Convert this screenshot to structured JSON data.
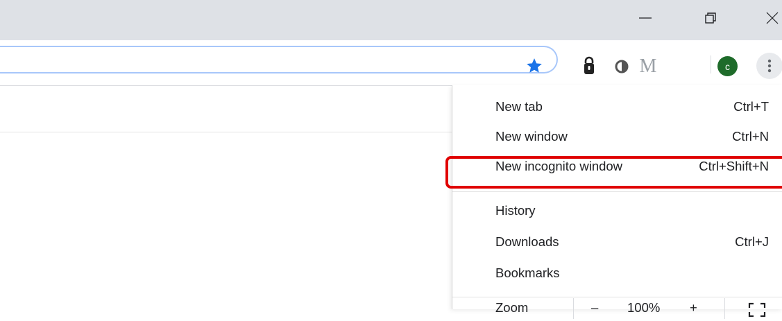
{
  "window_controls": {
    "minimize_icon": "minimize-icon",
    "restore_icon": "restore-icon",
    "close_icon": "close-icon"
  },
  "toolbar": {
    "avatar_letter": "c",
    "extension_m": "M",
    "colors": {
      "star": "#1a73e8",
      "avatar": "#1e6b2a",
      "highlight": "#e00000"
    }
  },
  "menu": {
    "items": [
      {
        "label": "New tab",
        "shortcut": "Ctrl+T"
      },
      {
        "label": "New window",
        "shortcut": "Ctrl+N"
      },
      {
        "label": "New incognito window",
        "shortcut": "Ctrl+Shift+N"
      },
      {
        "label": "History",
        "shortcut": ""
      },
      {
        "label": "Downloads",
        "shortcut": "Ctrl+J"
      },
      {
        "label": "Bookmarks",
        "shortcut": ""
      }
    ],
    "zoom": {
      "label": "Zoom",
      "minus": "–",
      "value": "100%",
      "plus": "+"
    }
  }
}
